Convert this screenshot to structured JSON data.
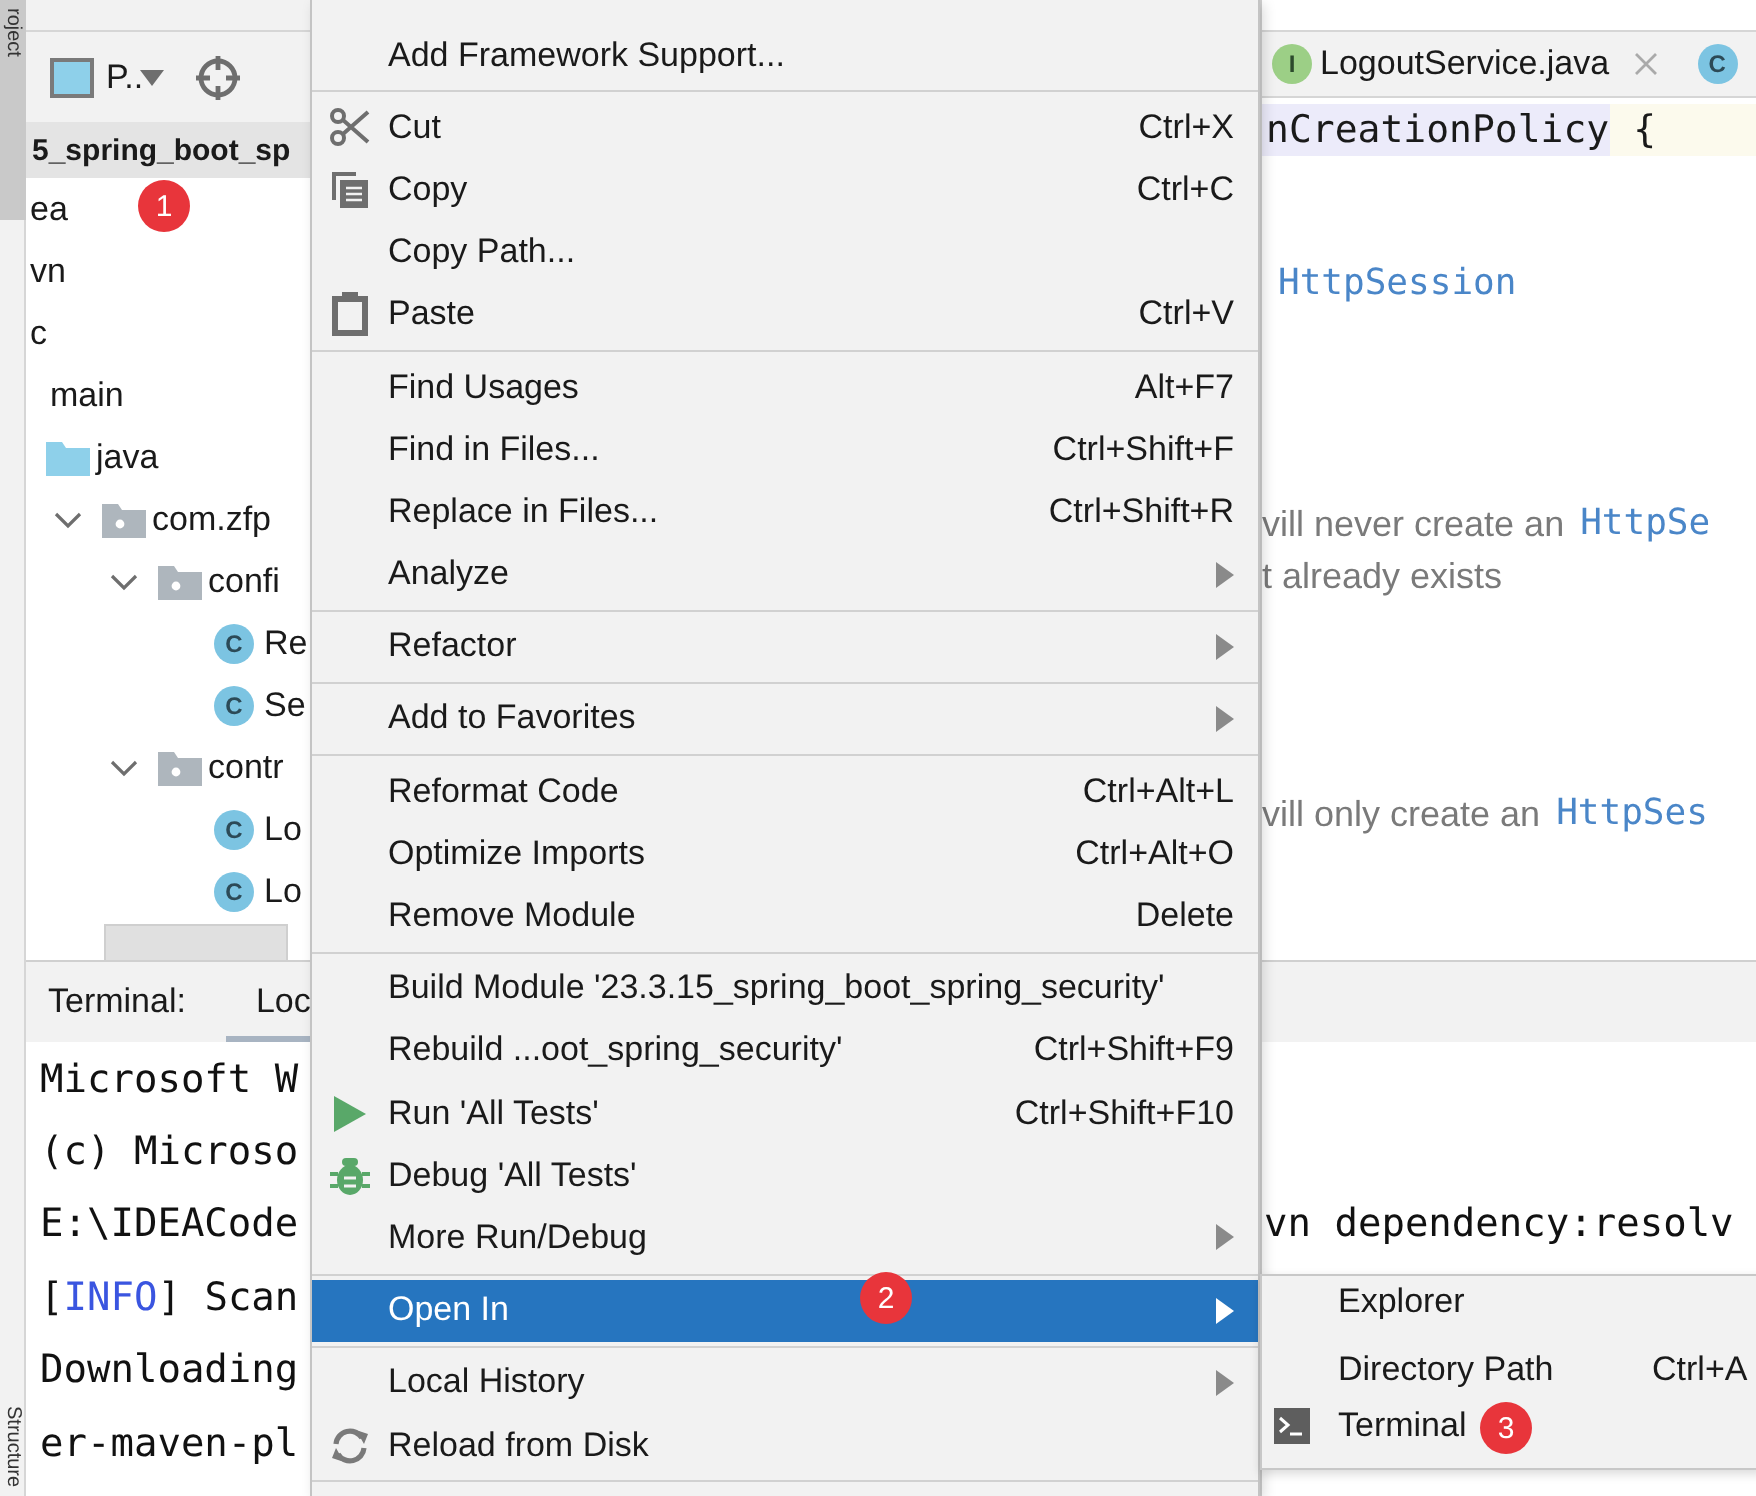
{
  "side_tabs": [
    {
      "label": "roject",
      "selected": true
    },
    {
      "label": "Structure",
      "selected": false
    }
  ],
  "project_panel": {
    "view_label": "P..",
    "header": "5_spring_boot_sp",
    "tree": [
      {
        "label": "ea"
      },
      {
        "label": "vn"
      },
      {
        "label": "c",
        "children": [
          {
            "label": "main",
            "children": [
              {
                "label": "java",
                "kind": "source-folder",
                "children": [
                  {
                    "label": "com.zfp",
                    "kind": "package",
                    "expanded": true,
                    "children": [
                      {
                        "label": "confi",
                        "kind": "package",
                        "expanded": true,
                        "children": [
                          {
                            "label": "Re",
                            "kind": "class",
                            "icon_letter": "C"
                          },
                          {
                            "label": "Se",
                            "kind": "class",
                            "icon_letter": "C"
                          }
                        ]
                      },
                      {
                        "label": "contr",
                        "kind": "package",
                        "expanded": true,
                        "children": [
                          {
                            "label": "Lo",
                            "kind": "class",
                            "icon_letter": "C"
                          },
                          {
                            "label": "Lo",
                            "kind": "class",
                            "icon_letter": "C"
                          }
                        ]
                      }
                    ]
                  }
                ]
              }
            ]
          }
        ]
      }
    ]
  },
  "editor": {
    "tabs": [
      {
        "label": "LogoutService.java",
        "icon_letter": "I",
        "kind": "interface",
        "selected": true
      },
      {
        "icon_letter": "C",
        "kind": "class",
        "selected": false
      }
    ],
    "lines": [
      [
        {
          "text": "nCreationPolicy",
          "kind": "code-selected"
        },
        {
          "text": "{",
          "kind": "code-current"
        }
      ],
      [
        {
          "text": "HttpSession",
          "kind": "code-link"
        }
      ],
      [
        {
          "text": "vill never create an",
          "kind": "doc"
        },
        {
          "text": "HttpSe",
          "kind": "code-link"
        }
      ],
      [
        {
          "text": "t already exists",
          "kind": "doc"
        }
      ],
      [
        {
          "text": "vill only create an",
          "kind": "doc"
        },
        {
          "text": "HttpSes",
          "kind": "code-link"
        }
      ]
    ]
  },
  "bottom_panel": {
    "title": "Terminal:",
    "tabs": [
      {
        "label": "Loc",
        "selected": true
      }
    ],
    "lines": [
      [
        {
          "text": "Microsoft W",
          "kind": "plain"
        }
      ],
      [
        {
          "text": "(c) Microso",
          "kind": "plain"
        }
      ],
      [
        {
          "text": "E:\\IDEACode",
          "kind": "plain"
        }
      ],
      [
        {
          "text": "[",
          "kind": "plain"
        },
        {
          "text": "INFO",
          "kind": "info"
        },
        {
          "text": "] Scan",
          "kind": "plain"
        }
      ],
      [
        {
          "text": "Downloading",
          "kind": "plain"
        }
      ],
      [
        {
          "text": "er-maven-pl",
          "kind": "plain"
        }
      ]
    ],
    "right_lines": [
      [
        {
          "text": "vn dependency:resolv",
          "kind": "plain"
        }
      ]
    ]
  },
  "context_menu": {
    "items": [
      {
        "kind": "item",
        "label": "Add Framework Support...",
        "submenu": false,
        "selected": false
      },
      {
        "kind": "separator"
      },
      {
        "kind": "item",
        "label": "Cut",
        "shortcut": "Ctrl+X",
        "submenu": false,
        "selected": false
      },
      {
        "kind": "item",
        "label": "Copy",
        "shortcut": "Ctrl+C",
        "submenu": false,
        "selected": false
      },
      {
        "kind": "item",
        "label": "Copy Path...",
        "submenu": false,
        "selected": false
      },
      {
        "kind": "item",
        "label": "Paste",
        "shortcut": "Ctrl+V",
        "submenu": false,
        "selected": false
      },
      {
        "kind": "separator"
      },
      {
        "kind": "item",
        "label": "Find Usages",
        "shortcut": "Alt+F7",
        "submenu": false,
        "selected": false
      },
      {
        "kind": "item",
        "label": "Find in Files...",
        "shortcut": "Ctrl+Shift+F",
        "submenu": false,
        "selected": false
      },
      {
        "kind": "item",
        "label": "Replace in Files...",
        "shortcut": "Ctrl+Shift+R",
        "submenu": false,
        "selected": false
      },
      {
        "kind": "item",
        "label": "Analyze",
        "submenu": true,
        "selected": false
      },
      {
        "kind": "separator"
      },
      {
        "kind": "item",
        "label": "Refactor",
        "submenu": true,
        "selected": false
      },
      {
        "kind": "separator"
      },
      {
        "kind": "item",
        "label": "Add to Favorites",
        "submenu": true,
        "selected": false
      },
      {
        "kind": "separator"
      },
      {
        "kind": "item",
        "label": "Reformat Code",
        "shortcut": "Ctrl+Alt+L",
        "submenu": false,
        "selected": false
      },
      {
        "kind": "item",
        "label": "Optimize Imports",
        "shortcut": "Ctrl+Alt+O",
        "submenu": false,
        "selected": false
      },
      {
        "kind": "item",
        "label": "Remove Module",
        "shortcut": "Delete",
        "submenu": false,
        "selected": false
      },
      {
        "kind": "separator"
      },
      {
        "kind": "item",
        "label": "Build Module '23.3.15_spring_boot_spring_security'",
        "submenu": false,
        "selected": false
      },
      {
        "kind": "item",
        "label": "Rebuild ...oot_spring_security'",
        "shortcut": "Ctrl+Shift+F9",
        "submenu": false,
        "selected": false
      },
      {
        "kind": "item",
        "label": "Run 'All Tests'",
        "shortcut": "Ctrl+Shift+F10",
        "submenu": false,
        "selected": false
      },
      {
        "kind": "item",
        "label": "Debug 'All Tests'",
        "submenu": false,
        "selected": false
      },
      {
        "kind": "item",
        "label": "More Run/Debug",
        "submenu": true,
        "selected": false
      },
      {
        "kind": "separator"
      },
      {
        "kind": "item",
        "label": "Open In",
        "submenu": true,
        "selected": true
      },
      {
        "kind": "separator"
      },
      {
        "kind": "item",
        "label": "Local History",
        "submenu": true,
        "selected": false
      },
      {
        "kind": "item",
        "label": "Reload from Disk",
        "submenu": false,
        "selected": false
      },
      {
        "kind": "separator"
      }
    ]
  },
  "submenu": {
    "items": [
      {
        "label": "Explorer",
        "selected": false
      },
      {
        "label": "Directory Path",
        "shortcut": "Ctrl+A",
        "selected": false
      },
      {
        "label": "Terminal",
        "selected": false
      }
    ]
  },
  "step_badges": [
    "1",
    "2",
    "3"
  ]
}
